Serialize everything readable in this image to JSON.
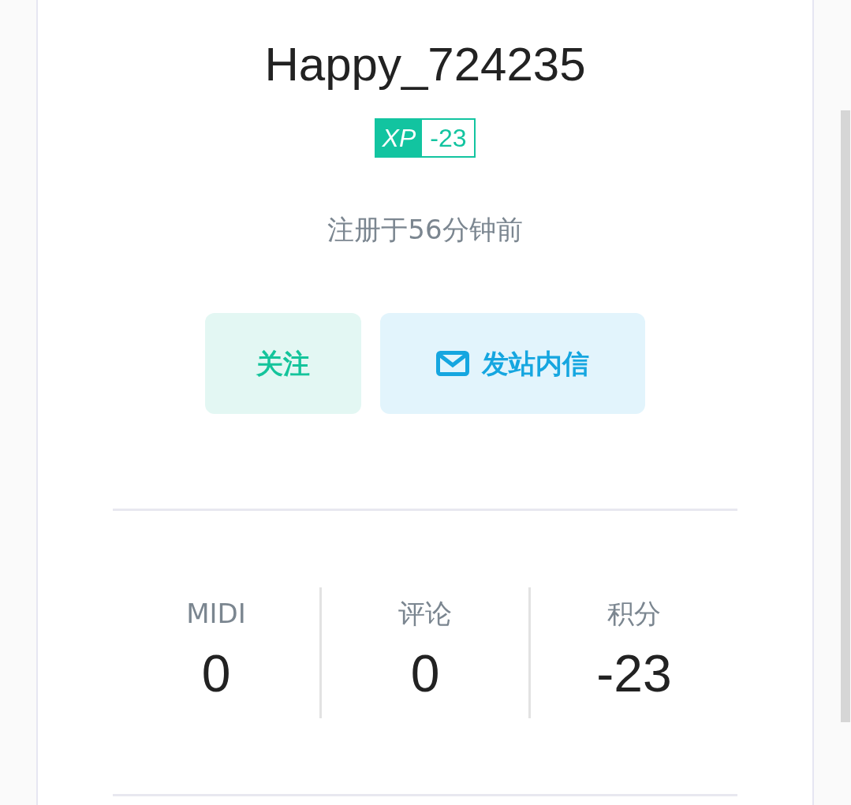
{
  "profile": {
    "username": "Happy_724235",
    "xp_badge": {
      "label": "XP",
      "value": "-23"
    },
    "registered": "注册于56分钟前"
  },
  "actions": [
    {
      "label": "关注",
      "kind": "follow"
    },
    {
      "label": "发站内信",
      "kind": "message"
    }
  ],
  "stats": [
    {
      "label": "MIDI",
      "value": "0"
    },
    {
      "label": "评论",
      "value": "0"
    },
    {
      "label": "积分",
      "value": "-23"
    }
  ]
}
